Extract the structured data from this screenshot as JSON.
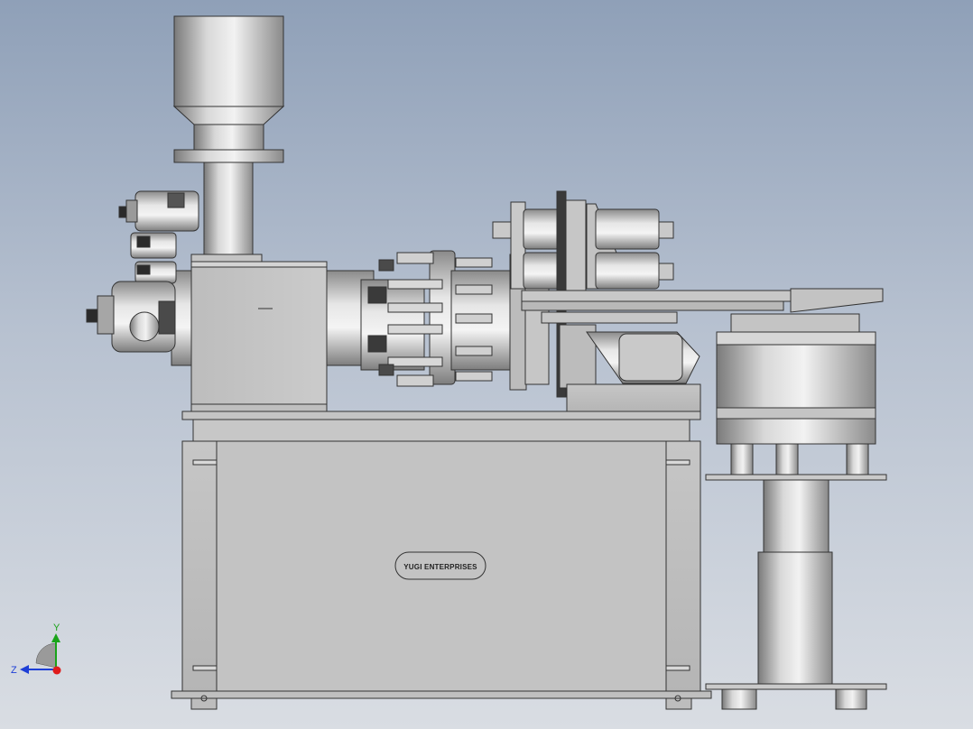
{
  "view": {
    "type": "cad-3d-model-viewport",
    "background_top": "#8fa0b8",
    "background_bottom": "#d9dde3",
    "model_color": "#c8c8c8"
  },
  "nameplate": {
    "text": "YUGI ENTERPRISES"
  },
  "triad": {
    "x_color": "#e01b1b",
    "y_label": "Y",
    "y_color": "#1aa31a",
    "z_label": "Z",
    "z_color": "#1e3fd6"
  }
}
